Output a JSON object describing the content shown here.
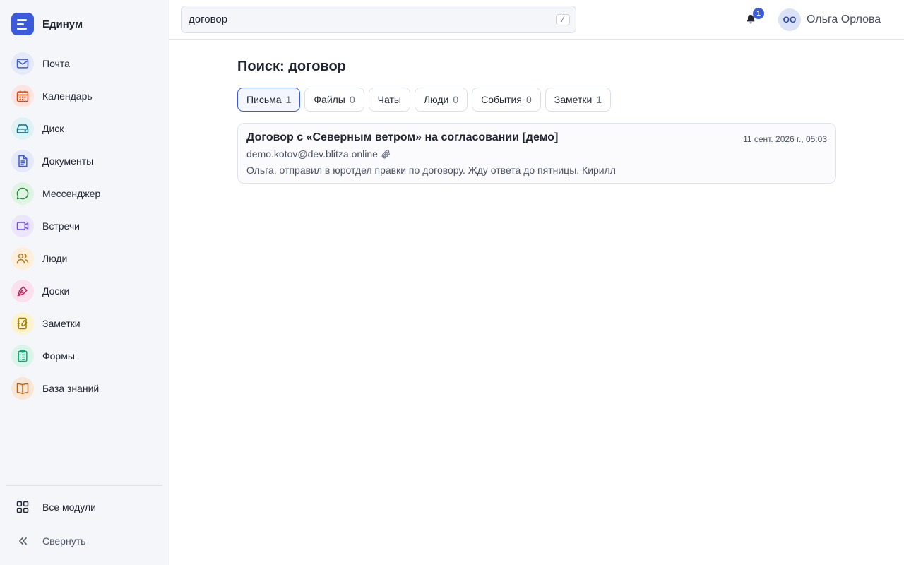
{
  "app": {
    "name": "Единум"
  },
  "sidebar": {
    "items": [
      {
        "label": "Почта",
        "icon": "mail-icon",
        "color": "#3b5bdb",
        "bg": "#e4e9fb"
      },
      {
        "label": "Календарь",
        "icon": "calendar-icon",
        "color": "#d9480f",
        "bg": "#fde4e1"
      },
      {
        "label": "Диск",
        "icon": "drive-icon",
        "color": "#0b7285",
        "bg": "#dff3f7"
      },
      {
        "label": "Документы",
        "icon": "document-icon",
        "color": "#3b5bdb",
        "bg": "#e4e9fb"
      },
      {
        "label": "Мессенджер",
        "icon": "chat-icon",
        "color": "#2b8a3e",
        "bg": "#e0f4e4"
      },
      {
        "label": "Встречи",
        "icon": "video-icon",
        "color": "#7048e8",
        "bg": "#ece6fd"
      },
      {
        "label": "Люди",
        "icon": "people-icon",
        "color": "#b7791f",
        "bg": "#fdefd9"
      },
      {
        "label": "Доски",
        "icon": "pen-icon",
        "color": "#c2255c",
        "bg": "#fce1ec"
      },
      {
        "label": "Заметки",
        "icon": "notes-icon",
        "color": "#a57a00",
        "bg": "#fcf3cf"
      },
      {
        "label": "Формы",
        "icon": "clipboard-icon",
        "color": "#0ca678",
        "bg": "#d9f5ea"
      },
      {
        "label": "База знаний",
        "icon": "book-icon",
        "color": "#b5651d",
        "bg": "#f8e6d6"
      }
    ],
    "all_modules": "Все модули",
    "collapse": "Свернуть"
  },
  "topbar": {
    "search_value": "договор",
    "search_shortcut": "/",
    "notifications_count": "1",
    "user_initials": "ОО",
    "user_name": "Ольга Орлова"
  },
  "main": {
    "title": "Поиск: договор",
    "tabs": [
      {
        "label": "Письма",
        "count": "1",
        "active": true
      },
      {
        "label": "Файлы",
        "count": "0"
      },
      {
        "label": "Чаты",
        "count": ""
      },
      {
        "label": "Люди",
        "count": "0"
      },
      {
        "label": "События",
        "count": "0"
      },
      {
        "label": "Заметки",
        "count": "1"
      }
    ],
    "results": [
      {
        "title": "Договор с «Северным ветром» на согласовании [демо]",
        "date": "11 сент. 2026 г., 05:03",
        "from": "demo.kotov@dev.blitza.online",
        "has_attachment": true,
        "snippet": "Ольга, отправил в юротдел правки по договору. Жду ответа до пятницы. Кирилл"
      }
    ]
  },
  "colors": {
    "accent": "#3b5bdb"
  }
}
